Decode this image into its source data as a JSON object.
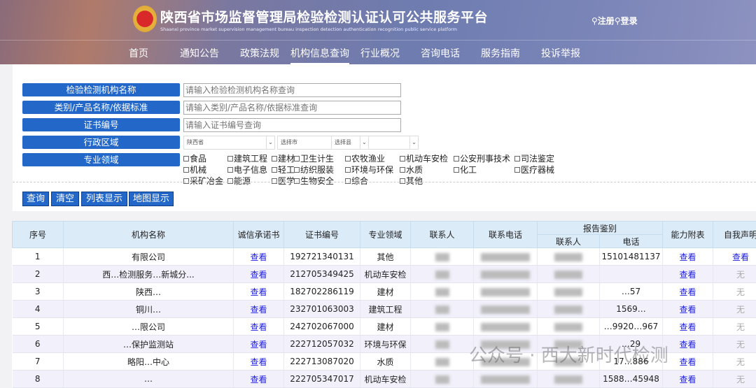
{
  "header": {
    "title": "陕西省市场监督管理局检验检测认证认可公共服务平台",
    "subtitle": "Shaanxi province market supervision management bureau inspection detection authentication recognition public service platform",
    "register": "注册",
    "login": "登录"
  },
  "nav": [
    "首页",
    "通知公告",
    "政策法规",
    "机构信息查询",
    "行业概况",
    "咨询电话",
    "服务指南",
    "投诉举报"
  ],
  "search": {
    "labels": [
      "检验检测机构名称",
      "类别/产品名称/依据标准",
      "证书编号",
      "行政区域",
      "专业领域"
    ],
    "placeholders": [
      "请输入检验检测机构名称查询",
      "请输入类别/产品名称/依据标准查询",
      "请输入证书编号查询"
    ],
    "province": "陕西省",
    "city": "选择市",
    "county": "选择县",
    "fields": [
      "食品",
      "建筑工程",
      "建材",
      "卫生计生",
      "农牧渔业",
      "机动车安检",
      "公安刑事技术",
      "司法鉴定",
      "机械",
      "电子信息",
      "轻工",
      "纺织服装",
      "环境与环保",
      "水质",
      "化工",
      "医疗器械",
      "采矿冶金",
      "能源",
      "医学",
      "生物安全",
      "综合",
      "其他"
    ],
    "buttons": [
      "查询",
      "清空",
      "列表显示",
      "地图显示"
    ]
  },
  "table": {
    "headers": [
      "序号",
      "机构名称",
      "诚信承诺书",
      "证书编号",
      "专业领域",
      "联系人",
      "联系电话",
      "报告鉴别",
      "能力附表",
      "自我声明"
    ],
    "subheaders": [
      "联系人",
      "电话"
    ],
    "rows": [
      {
        "no": "1",
        "name": "有限公司",
        "cert": "192721340131",
        "field": "其他",
        "phone2": "15101481137",
        "self": "查看"
      },
      {
        "no": "2",
        "name": "西…检测服务…新城分...",
        "cert": "212705349425",
        "field": "机动车安检",
        "phone2": "",
        "self": "无"
      },
      {
        "no": "3",
        "name": "陕西…",
        "cert": "182702286119",
        "field": "建材",
        "phone2": "…57",
        "self": "无"
      },
      {
        "no": "4",
        "name": "铜川…",
        "cert": "232701063003",
        "field": "建筑工程",
        "phone2": "1569…",
        "self": "无"
      },
      {
        "no": "5",
        "name": "…限公司",
        "cert": "242702067000",
        "field": "建材",
        "phone2": "…9920…967",
        "self": "无"
      },
      {
        "no": "6",
        "name": "…保护监测站",
        "cert": "222712057032",
        "field": "环境与环保",
        "phone2": "…29",
        "self": "无"
      },
      {
        "no": "7",
        "name": "略阳…中心",
        "cert": "222713087020",
        "field": "水质",
        "phone2": "17…886",
        "self": "无"
      },
      {
        "no": "8",
        "name": "…",
        "cert": "222705347017",
        "field": "机动车安检",
        "phone2": "1588…45948",
        "self": "无"
      }
    ],
    "view_label": "查看"
  },
  "watermark": "公众号 · 西大新时代检测"
}
